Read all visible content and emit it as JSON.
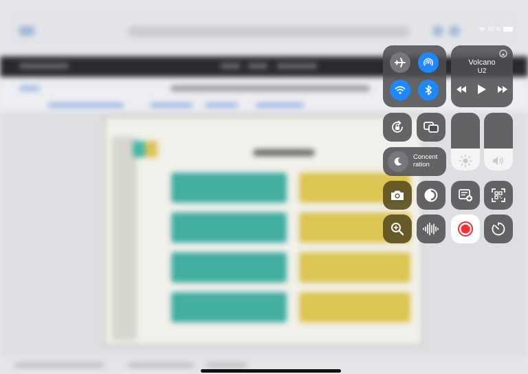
{
  "status_bar": {
    "wifi_icon": "wifi-icon",
    "battery_percent": "91 %"
  },
  "control_center": {
    "connectivity": {
      "airplane_mode": {
        "icon": "airplane-icon",
        "state": "off"
      },
      "airdrop": {
        "icon": "airdrop-icon",
        "state": "on"
      },
      "wifi": {
        "icon": "wifi-icon",
        "state": "on"
      },
      "bluetooth": {
        "icon": "bluetooth-icon",
        "state": "on"
      }
    },
    "now_playing": {
      "title": "Volcano",
      "artist": "U2",
      "airplay_icon": "airplay-icon",
      "controls": [
        "rewind-icon",
        "play-icon",
        "fast-forward-icon"
      ]
    },
    "orientation_lock": {
      "icon": "rotation-lock-icon"
    },
    "screen_mirroring": {
      "icon": "screen-mirroring-icon"
    },
    "focus": {
      "label_line1": "Concent",
      "label_line2": "ration",
      "icon": "moon-icon"
    },
    "brightness": {
      "icon": "sun-icon",
      "level_percent": 38
    },
    "volume": {
      "icon": "speaker-icon",
      "level_percent": 38
    },
    "buttons_row1": [
      "camera-icon",
      "dark-mode-icon",
      "notes-add-icon",
      "qr-code-scanner-icon"
    ],
    "buttons_row2": [
      "magnifier-icon",
      "sound-recognition-icon",
      "screen-record-icon",
      "timer-icon"
    ],
    "colors": {
      "accent_blue": "#1e88ff",
      "record_red": "#ff2d2d",
      "gold_tile": "#5c5024"
    }
  }
}
